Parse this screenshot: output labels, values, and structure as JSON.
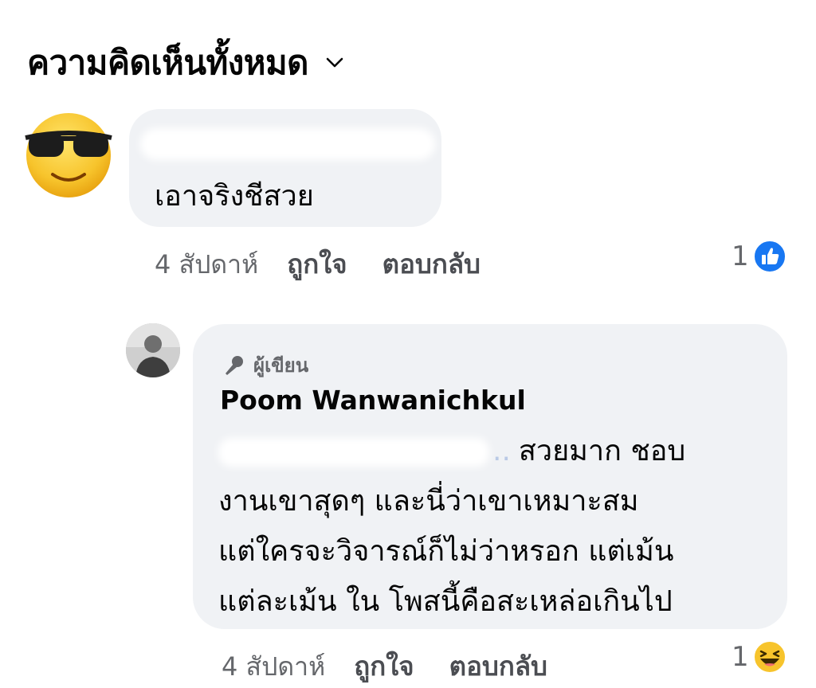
{
  "header": {
    "title": "ความคิดเห็นทั้งหมด"
  },
  "comments": [
    {
      "avatar_icon": "sunglasses-emoji-icon",
      "text": "เอาจริงชีสวย",
      "time": "4 สัปดาห์",
      "like_label": "ถูกใจ",
      "reply_label": "ตอบกลับ",
      "reaction_count": "1",
      "reaction_icon": "like-reaction-icon"
    },
    {
      "author_badge": "ผู้เขียน",
      "author_name": "Poom Wanwanichkul",
      "tag_ellipsis": "..",
      "lines": [
        "สวยมาก ชอบ",
        "งานเขาสุดๆ และนี่ว่าเขาเหมาะสม",
        "แต่ใครจะวิจารณ์ก็ไม่ว่าหรอก แต่เม้น",
        "แต่ละเม้น ใน โพสนี้คือสะเหล่อเกินไป"
      ],
      "time": "4 สัปดาห์",
      "like_label": "ถูกใจ",
      "reply_label": "ตอบกลับ",
      "reaction_count": "1",
      "reaction_icon": "haha-reaction-icon"
    }
  ],
  "colors": {
    "bubble": "#f0f2f5",
    "like_blue": "#1877f2",
    "meta_gray": "#65676b"
  }
}
